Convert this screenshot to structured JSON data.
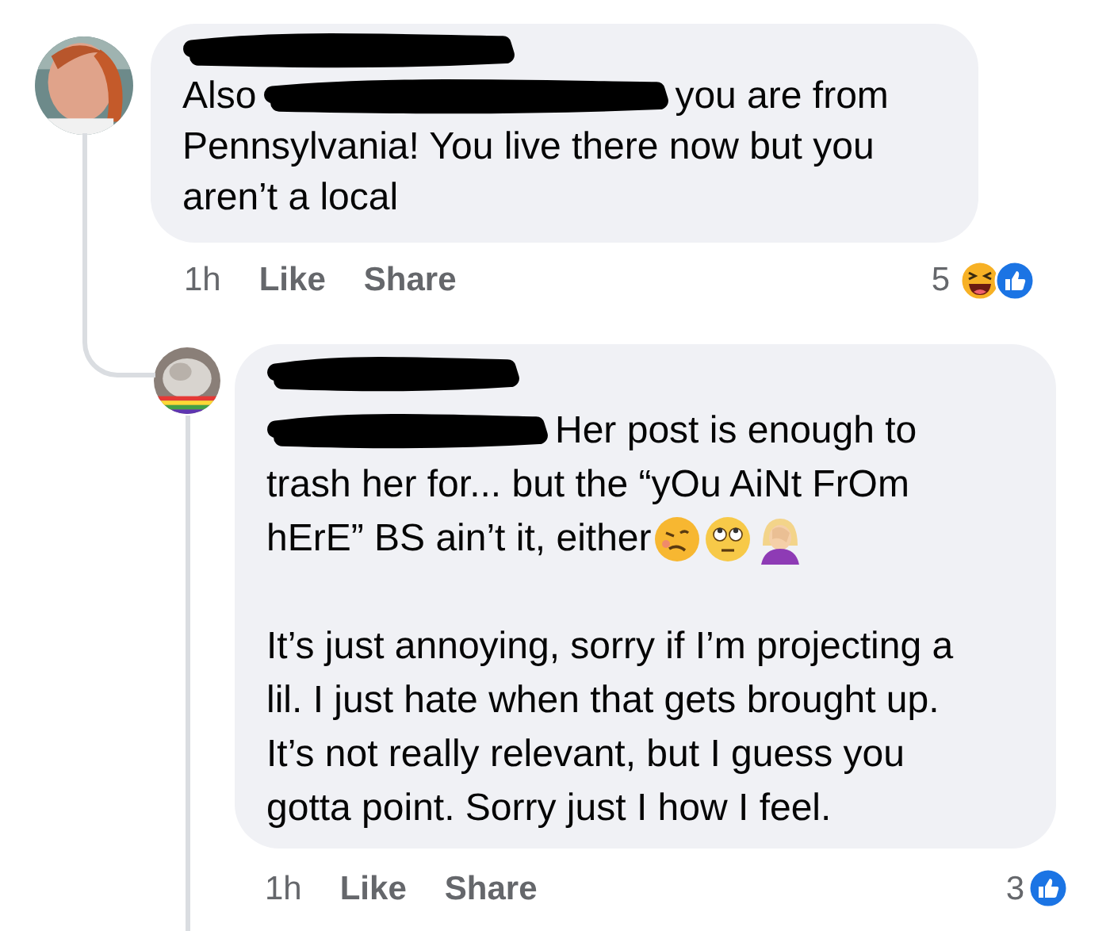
{
  "comments": [
    {
      "author": {
        "kind": "redacted"
      },
      "avatar": {
        "kind": "picture"
      },
      "paragraphs": [
        [
          [
            {
              "kind": "text",
              "text": "Also"
            },
            {
              "kind": "redacted"
            },
            {
              "kind": "text",
              "text": "you are from"
            }
          ],
          [
            {
              "kind": "text",
              "text": "Pennsylvania! You live there now but you"
            }
          ],
          [
            {
              "kind": "text",
              "text": "aren’t a local"
            }
          ]
        ]
      ],
      "time": "1h",
      "actions": [
        "Like",
        "Share"
      ],
      "reaction_count": "5",
      "reactions": [
        {
          "kind": "laugh"
        },
        {
          "kind": "like"
        }
      ],
      "reply": false
    },
    {
      "author": {
        "kind": "redacted"
      },
      "avatar": {
        "kind": "picture"
      },
      "paragraphs": [
        [
          [
            {
              "kind": "redacted"
            },
            {
              "kind": "text",
              "text": "Her post is enough to"
            }
          ],
          [
            {
              "kind": "text",
              "text": "trash her for... but the “yOu AiNt FrOm"
            }
          ],
          [
            {
              "kind": "text",
              "text": "hErE” BS ain’t it, either"
            },
            {
              "kind": "woozy"
            },
            {
              "kind": "eyeroll"
            },
            {
              "kind": "facepalm"
            }
          ]
        ],
        [
          [
            {
              "kind": "text",
              "text": "It’s just annoying, sorry if I’m projecting a"
            }
          ],
          [
            {
              "kind": "text",
              "text": "lil. I just hate when that gets brought up."
            }
          ],
          [
            {
              "kind": "text",
              "text": "It’s not really relevant, but I guess you"
            }
          ],
          [
            {
              "kind": "text",
              "text": "gotta point. Sorry just I how I feel."
            }
          ]
        ]
      ],
      "time": "1h",
      "actions": [
        "Like",
        "Share"
      ],
      "reaction_count": "3",
      "reactions": [
        {
          "kind": "like"
        }
      ],
      "reply": true
    }
  ]
}
